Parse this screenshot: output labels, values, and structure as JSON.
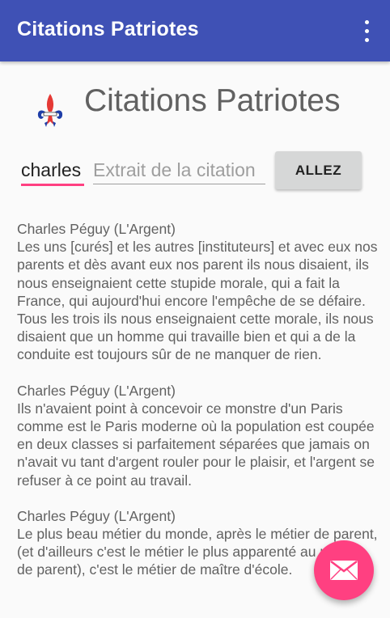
{
  "colors": {
    "primary": "#3f51b5",
    "accent": "#ff4081",
    "text_secondary": "#616161",
    "hint": "#9e9e9e",
    "button_bg": "#d6d7d7"
  },
  "appbar": {
    "title": "Citations Patriotes",
    "overflow_icon": "more-vert-icon"
  },
  "header": {
    "logo_icon": "fleur-de-lis-icon",
    "title": "Citations Patriotes"
  },
  "search": {
    "author_value": "charles",
    "extract_placeholder": "Extrait de la citation",
    "go_label": "ALLEZ"
  },
  "quotes": [
    {
      "author": "Charles Péguy (L'Argent)",
      "text": "Les uns [curés] et les autres [instituteurs] et avec eux nos parents et dès avant eux nos parent ils nous disaient, ils nous enseignaient cette stupide morale, qui a fait la France, qui aujourd'hui encore l'empêche de se défaire. Tous les trois ils nous enseignaient cette morale, ils nous disaient que un homme qui travaille bien et qui a de la conduite est toujours sûr de ne manquer de rien."
    },
    {
      "author": "Charles Péguy (L'Argent)",
      "text": "Ils n'avaient point à concevoir ce monstre d'un Paris comme est le Paris moderne où la population est coupée en deux classes si parfaitement séparées que jamais on n'avait vu tant d'argent rouler pour le plaisir, et l'argent se refuser à ce point au travail."
    },
    {
      "author": "Charles Péguy (L'Argent)",
      "text": "Le plus beau métier du monde, après le métier de parent, (et d'ailleurs c'est le métier le plus apparenté au métier de parent), c'est le métier de maître d'école."
    }
  ],
  "fab": {
    "icon": "mail-icon"
  }
}
